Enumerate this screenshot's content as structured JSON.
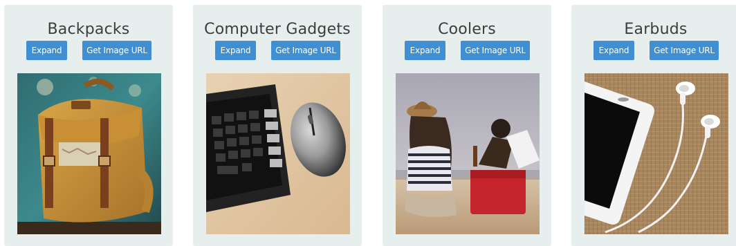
{
  "cards": [
    {
      "title": "Backpacks",
      "expand_label": "Expand",
      "url_label": "Get Image URL",
      "image": "backpack-photo"
    },
    {
      "title": "Computer Gadgets",
      "expand_label": "Expand",
      "url_label": "Get Image URL",
      "image": "keyboard-mouse-photo"
    },
    {
      "title": "Coolers",
      "expand_label": "Expand",
      "url_label": "Get Image URL",
      "image": "beach-cooler-photo"
    },
    {
      "title": "Earbuds",
      "expand_label": "Expand",
      "url_label": "Get Image URL",
      "image": "phone-earbuds-photo"
    }
  ],
  "colors": {
    "card_bg": "#e6eeee",
    "button_bg": "#3f8fd2",
    "title_text": "#3d3d3d"
  }
}
